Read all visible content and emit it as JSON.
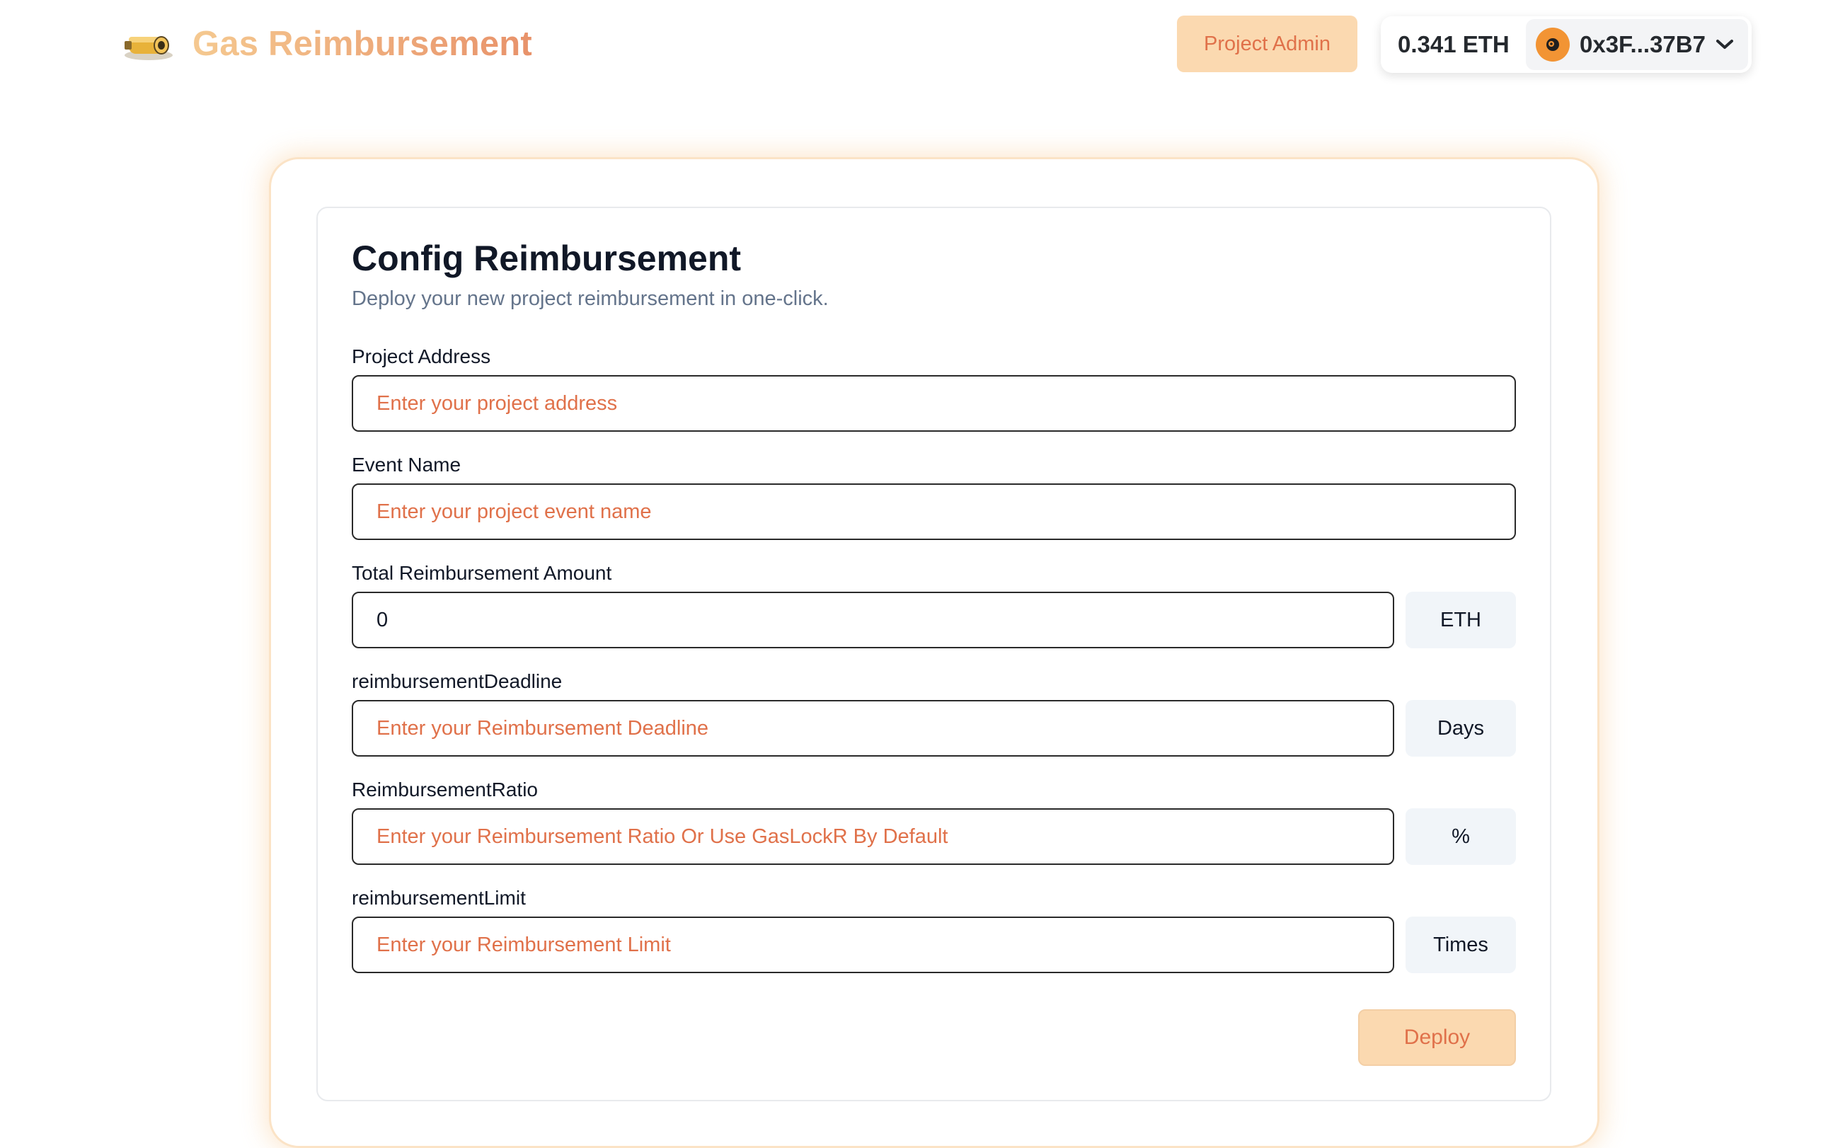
{
  "header": {
    "logo_icon": "gas-cylinder-icon",
    "title": "Gas Reimbursement",
    "admin_button": "Project Admin",
    "wallet": {
      "balance": "0.341 ETH",
      "address": "0x3F...37B7",
      "avatar_icon": "avatar-icon",
      "dropdown_icon": "chevron-down-icon"
    }
  },
  "form": {
    "title": "Config Reimbursement",
    "description": "Deploy your new project reimbursement in one-click.",
    "fields": [
      {
        "label": "Project Address",
        "value": "",
        "placeholder": "Enter your project address"
      },
      {
        "label": "Event Name",
        "value": "",
        "placeholder": "Enter your project event name"
      },
      {
        "label": "Total Reimbursement Amount",
        "value": "0",
        "placeholder": "",
        "unit": "ETH"
      },
      {
        "label": "reimbursementDeadline",
        "value": "",
        "placeholder": "Enter your Reimbursement Deadline",
        "unit": "Days"
      },
      {
        "label": "ReimbursementRatio",
        "value": "",
        "placeholder": "Enter your Reimbursement Ratio Or Use GasLockR By Default",
        "unit": "%"
      },
      {
        "label": "reimbursementLimit",
        "value": "",
        "placeholder": "Enter your Reimbursement Limit",
        "unit": "Times"
      }
    ],
    "deploy_button": "Deploy"
  },
  "colors": {
    "accent": "#e0714a",
    "button_bg": "#fbd9b0",
    "card_glow": "#fbe3c6",
    "unit_bg": "#f1f5f9",
    "avatar_bg": "#f29434"
  }
}
